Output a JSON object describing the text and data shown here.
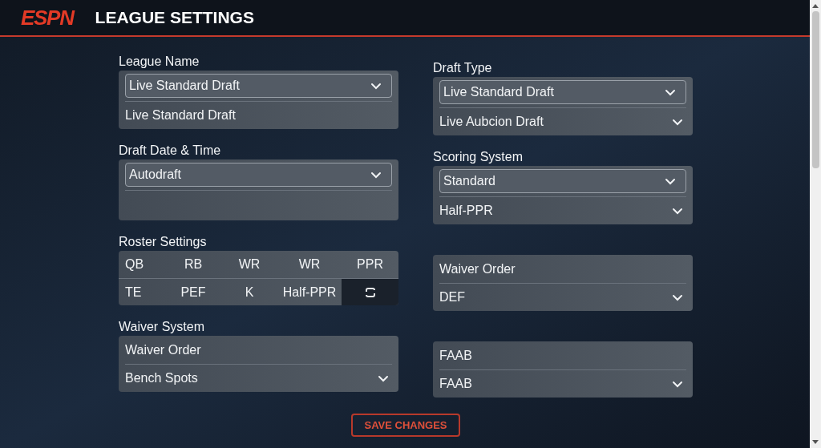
{
  "header": {
    "logo": "ESPN",
    "title": "LEAGUE SETTINGS"
  },
  "columns": [
    {
      "sections": [
        {
          "kind": "card",
          "label": "League Name",
          "rows": [
            {
              "kind": "select",
              "text": "Live Standard Draft"
            },
            {
              "kind": "option",
              "text": "Live Standard Draft",
              "caret": false
            }
          ]
        },
        {
          "kind": "card",
          "label": "Draft Date & Time",
          "rows": [
            {
              "kind": "select",
              "text": "Autodraft"
            },
            {
              "kind": "empty"
            }
          ]
        },
        {
          "kind": "roster",
          "label": "Roster Settings",
          "rows": [
            [
              {
                "kind": "text",
                "text": "QB"
              },
              {
                "kind": "text",
                "text": "RB"
              },
              {
                "kind": "text",
                "text": "WR"
              },
              {
                "kind": "text",
                "text": "WR"
              },
              {
                "kind": "text",
                "text": "PPR"
              }
            ],
            [
              {
                "kind": "text",
                "text": "TE"
              },
              {
                "kind": "text",
                "text": "PEF"
              },
              {
                "kind": "text",
                "text": "K"
              },
              {
                "kind": "text",
                "text": "Half-PPR"
              },
              {
                "kind": "swap"
              }
            ]
          ]
        },
        {
          "kind": "card",
          "label": "Waiver System",
          "rows": [
            {
              "kind": "option",
              "text": "Waiver Order",
              "caret": false
            },
            {
              "kind": "option",
              "text": "Bench Spots",
              "caret": true
            }
          ]
        }
      ]
    },
    {
      "sections": [
        {
          "kind": "card",
          "label": "Draft Type",
          "rows": [
            {
              "kind": "select",
              "text": "Live Standard Draft"
            },
            {
              "kind": "option",
              "text": "Live Aubcion Draft",
              "caret": true
            }
          ]
        },
        {
          "kind": "card",
          "label": "Scoring System",
          "rows": [
            {
              "kind": "select",
              "text": "Standard"
            },
            {
              "kind": "option",
              "text": "Half-PPR",
              "caret": true
            }
          ]
        },
        {
          "kind": "card",
          "rows": [
            {
              "kind": "option",
              "text": "Waiver Order",
              "caret": false
            },
            {
              "kind": "option",
              "text": "DEF",
              "caret": true
            }
          ]
        },
        {
          "kind": "card",
          "rows": [
            {
              "kind": "option",
              "text": "FAAB",
              "caret": false
            },
            {
              "kind": "option",
              "text": "FAAB",
              "caret": true
            }
          ]
        }
      ]
    }
  ],
  "save_button": "SAVE CHANGES"
}
